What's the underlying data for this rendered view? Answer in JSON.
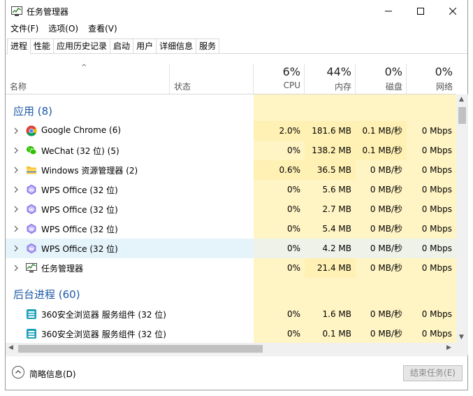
{
  "window": {
    "title": "任务管理器"
  },
  "menu": [
    "文件(F)",
    "选项(O)",
    "查看(V)"
  ],
  "tabs": [
    "进程",
    "性能",
    "应用历史记录",
    "启动",
    "用户",
    "详细信息",
    "服务"
  ],
  "active_tab": "进程",
  "columns": {
    "name": "名称",
    "status": "状态",
    "cpu": {
      "pct": "6%",
      "label": "CPU"
    },
    "memory": {
      "pct": "44%",
      "label": "内存"
    },
    "disk": {
      "pct": "0%",
      "label": "磁盘"
    },
    "network": {
      "pct": "0%",
      "label": "网络"
    }
  },
  "groups": [
    {
      "title": "应用 (8)"
    },
    {
      "title": "后台进程 (60)"
    }
  ],
  "apps": [
    {
      "name": "Google Chrome (6)",
      "icon": "chrome-icon",
      "cpu": "2.0%",
      "mem": "181.6 MB",
      "disk": "0.1 MB/秒",
      "net": "0 Mbps"
    },
    {
      "name": "WeChat (32 位) (5)",
      "icon": "wechat-icon",
      "cpu": "0%",
      "mem": "138.2 MB",
      "disk": "0.1 MB/秒",
      "net": "0 Mbps"
    },
    {
      "name": "Windows 资源管理器 (2)",
      "icon": "folder-icon",
      "cpu": "0.6%",
      "mem": "36.5 MB",
      "disk": "0 MB/秒",
      "net": "0 Mbps"
    },
    {
      "name": "WPS Office (32 位)",
      "icon": "wps-icon",
      "cpu": "0%",
      "mem": "5.6 MB",
      "disk": "0 MB/秒",
      "net": "0 Mbps"
    },
    {
      "name": "WPS Office (32 位)",
      "icon": "wps-icon",
      "cpu": "0%",
      "mem": "2.7 MB",
      "disk": "0 MB/秒",
      "net": "0 Mbps"
    },
    {
      "name": "WPS Office (32 位)",
      "icon": "wps-icon",
      "cpu": "0%",
      "mem": "5.4 MB",
      "disk": "0 MB/秒",
      "net": "0 Mbps"
    },
    {
      "name": "WPS Office (32 位)",
      "icon": "wps-icon",
      "cpu": "0%",
      "mem": "4.2 MB",
      "disk": "0 MB/秒",
      "net": "0 Mbps"
    },
    {
      "name": "任务管理器",
      "icon": "task-manager-icon",
      "cpu": "0%",
      "mem": "21.4 MB",
      "disk": "0 MB/秒",
      "net": "0 Mbps"
    }
  ],
  "background": [
    {
      "name": "360安全浏览器 服务组件 (32 位)",
      "icon": "360-browser-icon",
      "cpu": "0%",
      "mem": "1.6 MB",
      "disk": "0 MB/秒",
      "net": "0 Mbps"
    },
    {
      "name": "360安全浏览器 服务组件 (32 位)",
      "icon": "360-browser-icon",
      "cpu": "0%",
      "mem": "0.1 MB",
      "disk": "0 MB/秒",
      "net": "0 Mbps"
    }
  ],
  "footer": {
    "fewer_details": "简略信息(D)",
    "end_task": "结束任务(E)"
  }
}
